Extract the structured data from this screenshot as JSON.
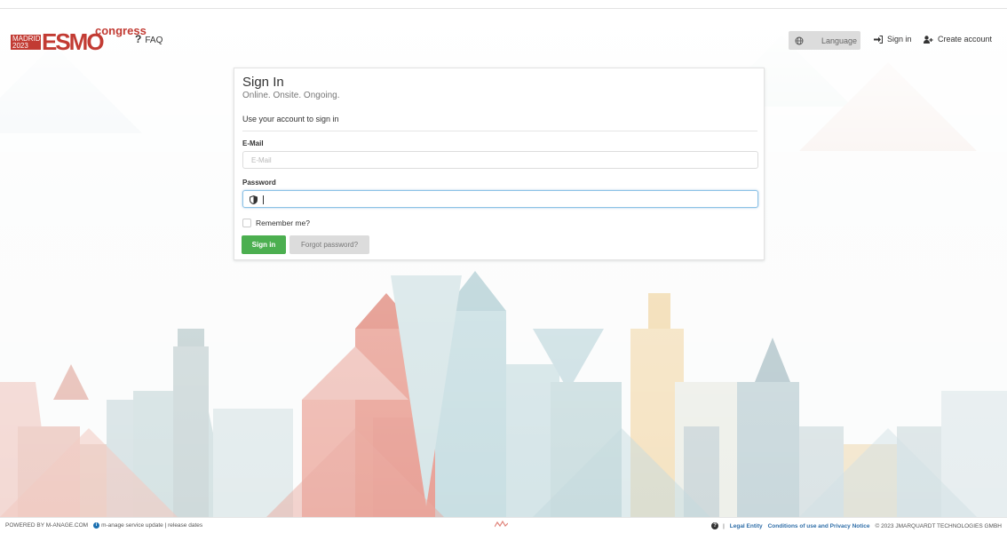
{
  "header": {
    "logo_city": "MADRID\n2023",
    "logo_brand": "ESMO",
    "logo_tag": "congress",
    "faq_label": "FAQ",
    "language_label": "Language",
    "sign_in_label": "Sign in",
    "create_account_label": "Create account"
  },
  "card": {
    "title": "Sign In",
    "subtitle": "Online. Onsite. Ongoing.",
    "intro": "Use your account to sign in",
    "email_label": "E-Mail",
    "email_placeholder": "E-Mail",
    "password_label": "Password",
    "remember_label": "Remember me?",
    "signin_button": "Sign in",
    "forgot_button": "Forgot password?"
  },
  "footer": {
    "powered": "POWERED BY M-ANAGE.COM",
    "service_update": "m-anage service update | release dates",
    "divider": "|",
    "legal": "Legal Entity",
    "conditions": "Conditions of use and Privacy Notice",
    "copyright": "© 2023 JMARQUARDT TECHNOLOGIES GMBH"
  },
  "colors": {
    "brand_red": "#c23b33",
    "signin_green": "#4caf50",
    "link_blue": "#2f6ea8",
    "focus_blue": "#8cc2e6"
  }
}
